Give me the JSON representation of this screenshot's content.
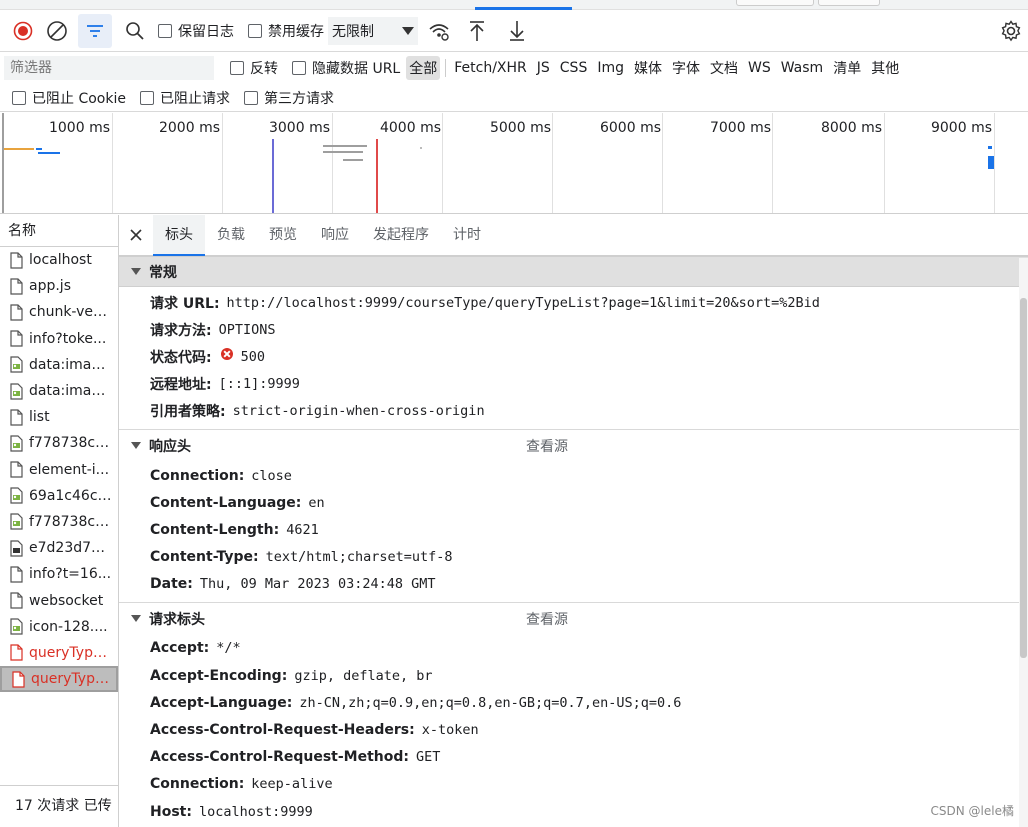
{
  "toolbar": {
    "preserve_log": "保留日志",
    "disable_cache": "禁用缓存",
    "throttle": "无限制"
  },
  "filter": {
    "placeholder": "筛选器",
    "invert": "反转",
    "hide_data_urls": "隐藏数据 URL",
    "types": [
      "全部",
      "Fetch/XHR",
      "JS",
      "CSS",
      "Img",
      "媒体",
      "字体",
      "文档",
      "WS",
      "Wasm",
      "清单",
      "其他"
    ]
  },
  "block": {
    "blocked_cookies": "已阻止 Cookie",
    "blocked_requests": "已阻止请求",
    "third_party": "第三方请求"
  },
  "overview": {
    "ticks": [
      "1000 ms",
      "2000 ms",
      "3000 ms",
      "4000 ms",
      "5000 ms",
      "6000 ms",
      "7000 ms",
      "8000 ms",
      "9000 ms"
    ]
  },
  "requests": {
    "header": "名称",
    "items": [
      {
        "name": "localhost",
        "icon": "document-icon",
        "error": false,
        "selected": false
      },
      {
        "name": "app.js",
        "icon": "script-icon",
        "error": false,
        "selected": false
      },
      {
        "name": "chunk-ven...",
        "icon": "script-icon",
        "error": false,
        "selected": false
      },
      {
        "name": "info?toke...",
        "icon": "document-icon",
        "error": false,
        "selected": false
      },
      {
        "name": "data:imag...",
        "icon": "image-icon",
        "error": false,
        "selected": false
      },
      {
        "name": "data:imag...",
        "icon": "image-icon",
        "error": false,
        "selected": false
      },
      {
        "name": "list",
        "icon": "document-icon",
        "error": false,
        "selected": false
      },
      {
        "name": "f778738c-...",
        "icon": "image-icon",
        "error": false,
        "selected": false
      },
      {
        "name": "element-i...",
        "icon": "document-icon",
        "error": false,
        "selected": false
      },
      {
        "name": "69a1c46c-...",
        "icon": "image-icon",
        "error": false,
        "selected": false
      },
      {
        "name": "f778738c-...",
        "icon": "image-icon",
        "error": false,
        "selected": false
      },
      {
        "name": "e7d23d71...",
        "icon": "font-icon",
        "error": false,
        "selected": false
      },
      {
        "name": "info?t=16...",
        "icon": "document-icon",
        "error": false,
        "selected": false
      },
      {
        "name": "websocket",
        "icon": "document-icon",
        "error": false,
        "selected": false
      },
      {
        "name": "icon-128....",
        "icon": "image-icon",
        "error": false,
        "selected": false
      },
      {
        "name": "queryType...",
        "icon": "document-icon",
        "error": true,
        "selected": false
      },
      {
        "name": "queryType...",
        "icon": "document-icon",
        "error": true,
        "selected": true
      }
    ],
    "status": "17 次请求  已传"
  },
  "detail": {
    "tabs": [
      "标头",
      "负载",
      "预览",
      "响应",
      "发起程序",
      "计时"
    ],
    "general": {
      "title": "常规",
      "rows": [
        {
          "k": "请求 URL:",
          "v": "http://localhost:9999/courseType/queryTypeList?page=1&limit=20&sort=%2Bid"
        },
        {
          "k": "请求方法:",
          "v": "OPTIONS"
        },
        {
          "k": "状态代码:",
          "v": "500"
        },
        {
          "k": "远程地址:",
          "v": "[::1]:9999"
        },
        {
          "k": "引用者策略:",
          "v": "strict-origin-when-cross-origin"
        }
      ]
    },
    "response_headers": {
      "title": "响应头",
      "view_source": "查看源",
      "rows": [
        {
          "k": "Connection:",
          "v": "close"
        },
        {
          "k": "Content-Language:",
          "v": "en"
        },
        {
          "k": "Content-Length:",
          "v": "4621"
        },
        {
          "k": "Content-Type:",
          "v": "text/html;charset=utf-8"
        },
        {
          "k": "Date:",
          "v": "Thu, 09 Mar 2023 03:24:48 GMT"
        }
      ]
    },
    "request_headers": {
      "title": "请求标头",
      "view_source": "查看源",
      "rows": [
        {
          "k": "Accept:",
          "v": "*/*"
        },
        {
          "k": "Accept-Encoding:",
          "v": "gzip, deflate, br"
        },
        {
          "k": "Accept-Language:",
          "v": "zh-CN,zh;q=0.9,en;q=0.8,en-GB;q=0.7,en-US;q=0.6"
        },
        {
          "k": "Access-Control-Request-Headers:",
          "v": "x-token"
        },
        {
          "k": "Access-Control-Request-Method:",
          "v": "GET"
        },
        {
          "k": "Connection:",
          "v": "keep-alive"
        },
        {
          "k": "Host:",
          "v": "localhost:9999"
        }
      ]
    }
  },
  "watermark": "CSDN @lele橘",
  "colors": {
    "accent": "#1a73e8",
    "error": "#d93025",
    "record": "#d93025"
  }
}
